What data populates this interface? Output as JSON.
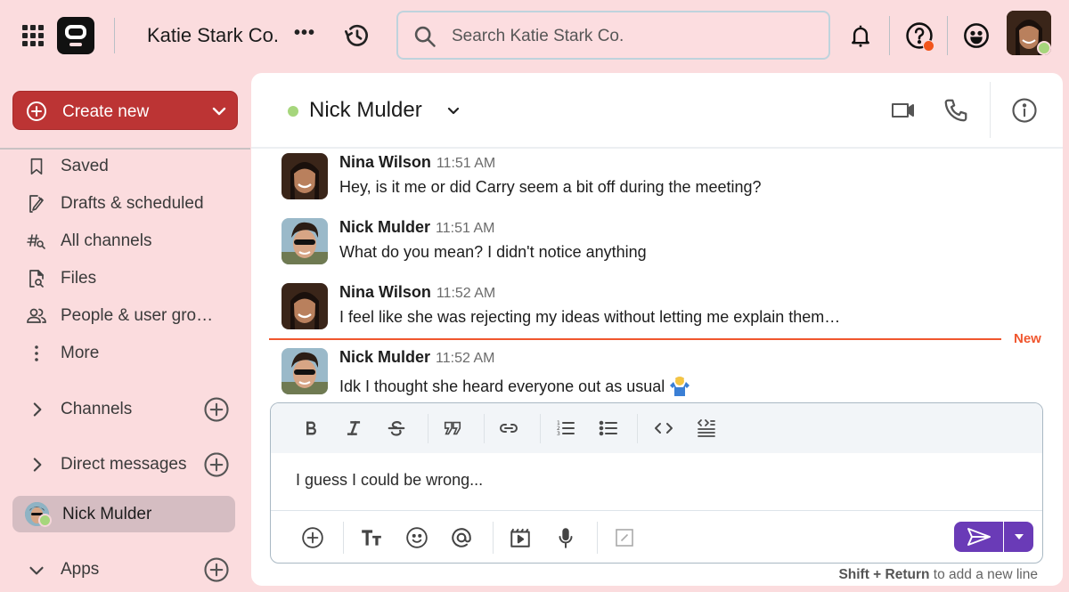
{
  "topbar": {
    "workspace_name": "Katie Stark Co.",
    "more_label": "•••",
    "search_placeholder": "Search Katie Stark Co.",
    "help_badge_color": "#f2541b",
    "status_color": "#a6d67c"
  },
  "sidebar": {
    "create_new_label": "Create new",
    "create_new_color": "#bc3434",
    "nav_items": [
      {
        "label": "Saved",
        "icon": "bookmark-icon"
      },
      {
        "label": "Drafts & scheduled",
        "icon": "draft-edit-icon"
      },
      {
        "label": "All channels",
        "icon": "channel-search-icon"
      },
      {
        "label": "Files",
        "icon": "file-search-icon"
      },
      {
        "label": "People & user gro…",
        "icon": "people-icon"
      },
      {
        "label": "More",
        "icon": "more-vertical-icon"
      }
    ],
    "sections": [
      {
        "label": "Channels",
        "expanded": false
      },
      {
        "label": "Direct messages",
        "expanded": false
      },
      {
        "label": "Apps",
        "expanded": true
      }
    ],
    "direct_messages": [
      {
        "name": "Nick Mulder",
        "status": "online",
        "selected": true
      }
    ]
  },
  "chat": {
    "contact_name": "Nick Mulder",
    "contact_status": "online",
    "messages": [
      {
        "author": "Nina Wilson",
        "time": "11:51 AM",
        "text": "Hey, is it me or did Carry seem a bit off during the meeting?"
      },
      {
        "author": "Nick Mulder",
        "time": "11:51 AM",
        "text": "What do you mean? I didn't notice anything"
      },
      {
        "author": "Nina Wilson",
        "time": "11:52 AM",
        "text": "I feel like she was rejecting my ideas without letting me explain them…"
      },
      {
        "author": "Nick Mulder",
        "time": "11:52 AM",
        "text": "Idk I thought she heard everyone out as usual",
        "emoji": "person-shrugging"
      }
    ],
    "new_divider_label": "New",
    "new_divider_color": "#f0562e"
  },
  "composer": {
    "formatting_tools": [
      "bold",
      "italic",
      "strikethrough",
      "quote",
      "link",
      "numbered-list",
      "bulleted-list",
      "code",
      "code-block"
    ],
    "input_value": "I guess I could be wrong...",
    "action_tools": [
      "attach",
      "text-format",
      "emoji",
      "mention",
      "video-clip",
      "voice-message",
      "slash-command"
    ],
    "send_color": "#6a3bb7",
    "hint_bold": "Shift + Return",
    "hint_rest": " to add a new line"
  }
}
